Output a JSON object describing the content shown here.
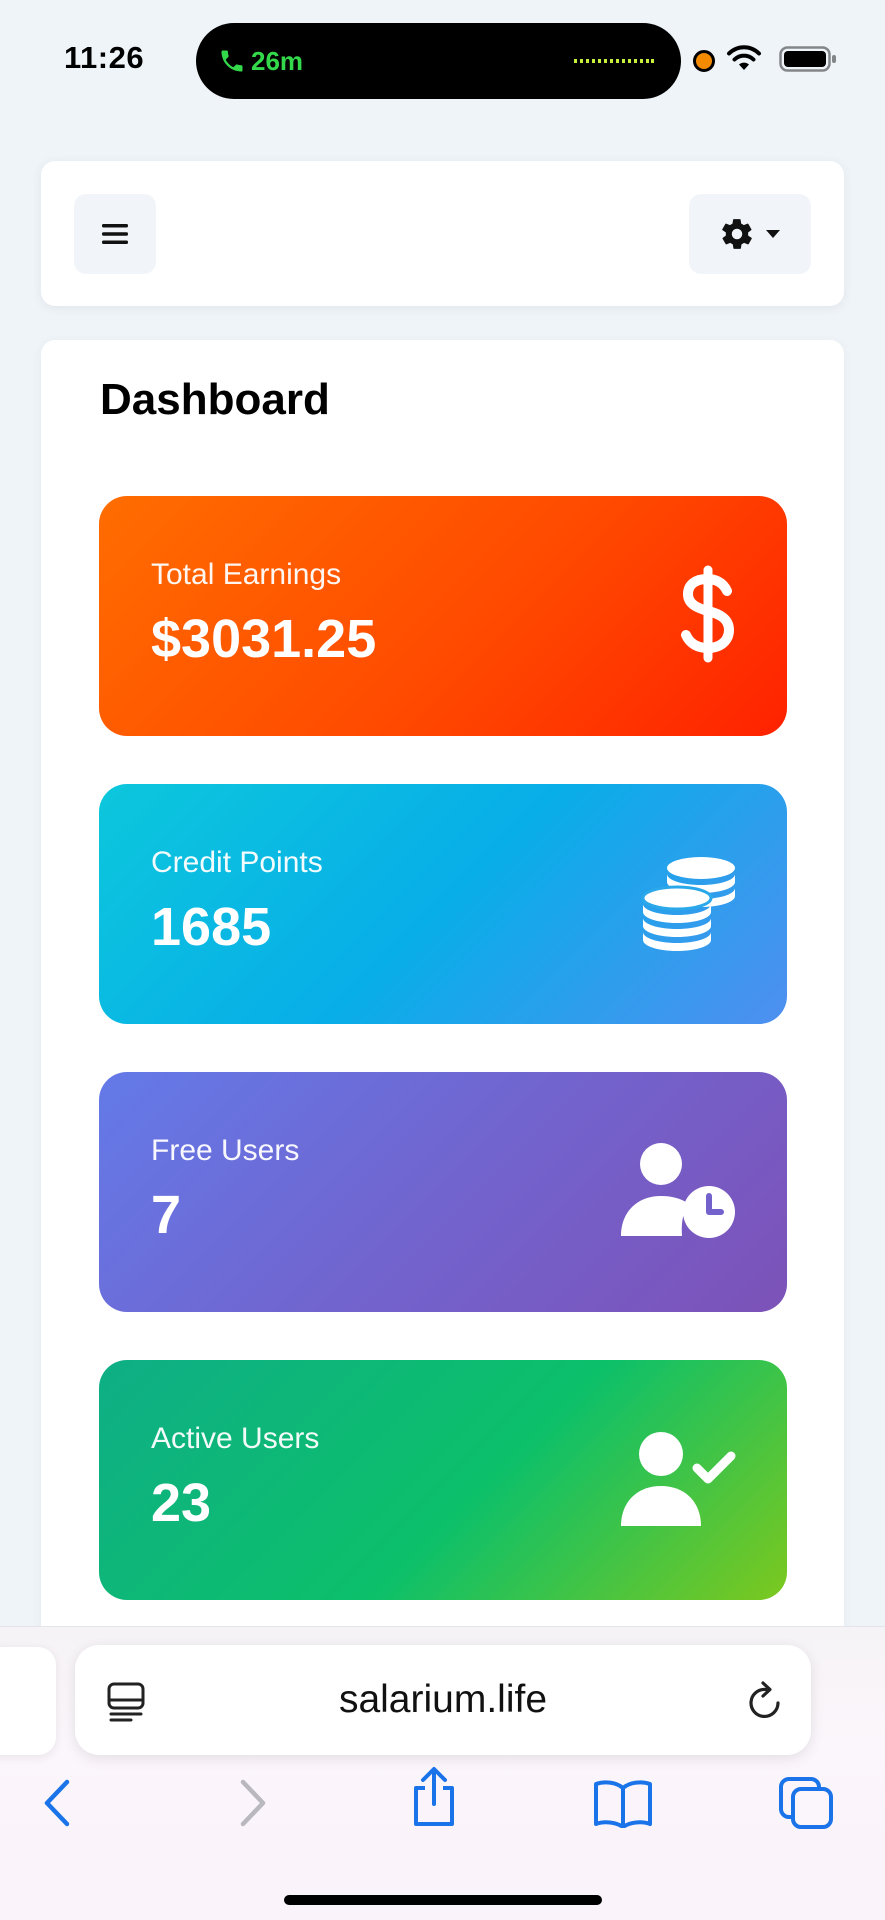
{
  "status_bar": {
    "time": "11:26",
    "call_duration": "26m",
    "icons": [
      "phone-icon",
      "audio-wave-icon",
      "recording-dot-icon",
      "wifi-icon",
      "battery-icon"
    ]
  },
  "header": {
    "menu_icon": "hamburger-menu-icon",
    "settings_icon": "gear-icon",
    "settings_dropdown_icon": "caret-down-icon"
  },
  "dashboard": {
    "title": "Dashboard",
    "cards": [
      {
        "label": "Total Earnings",
        "value": "$3031.25",
        "icon": "dollar-icon",
        "gradient": [
          "#ff6d00",
          "#ff2200"
        ]
      },
      {
        "label": "Credit Points",
        "value": "1685",
        "icon": "coins-icon",
        "gradient": [
          "#0cc7dc",
          "#4f8ff0"
        ]
      },
      {
        "label": "Free Users",
        "value": "7",
        "icon": "user-clock-icon",
        "gradient": [
          "#637ae8",
          "#7c52b8"
        ]
      },
      {
        "label": "Active Users",
        "value": "23",
        "icon": "user-check-icon",
        "gradient": [
          "#0fae86",
          "#7cc81e"
        ]
      }
    ]
  },
  "browser": {
    "url": "salarium.life",
    "accent": "#1a73e8",
    "toolbar": [
      "back-icon",
      "forward-icon",
      "share-icon",
      "bookmarks-icon",
      "tabs-icon"
    ]
  }
}
